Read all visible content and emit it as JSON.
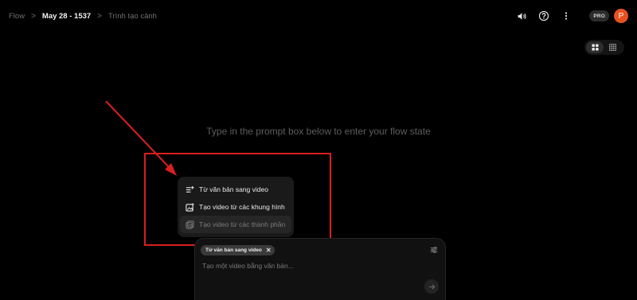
{
  "header": {
    "breadcrumb": {
      "root": "Flow",
      "project": "May 28 - 1537",
      "page": "Trình tạo cảnh"
    },
    "icons": [
      "volume-icon",
      "help-icon",
      "more-vert-icon"
    ],
    "plan_badge": "PRO",
    "avatar_initial": "P"
  },
  "view_toggle": {
    "options": [
      "grid-large",
      "grid-small"
    ],
    "selected": "grid-large"
  },
  "empty_state": {
    "message": "Type in the prompt box below to enter your flow state"
  },
  "mode_menu": {
    "items": [
      {
        "label": "Từ văn bản sang video",
        "icon": "text-to-video-icon",
        "enabled": true
      },
      {
        "label": "Tạo video từ các khung hình",
        "icon": "frames-to-video-icon",
        "enabled": true
      },
      {
        "label": "Tạo video từ các thành phần",
        "icon": "ingredients-to-video-icon",
        "enabled": false
      }
    ]
  },
  "prompt_box": {
    "mode_chip": "Từ văn bản sang video",
    "placeholder": "Tạo một video bằng văn bản...",
    "value": ""
  },
  "colors": {
    "background": "#000000",
    "annotation_red": "#d81f1f",
    "avatar": "#e8511f"
  }
}
